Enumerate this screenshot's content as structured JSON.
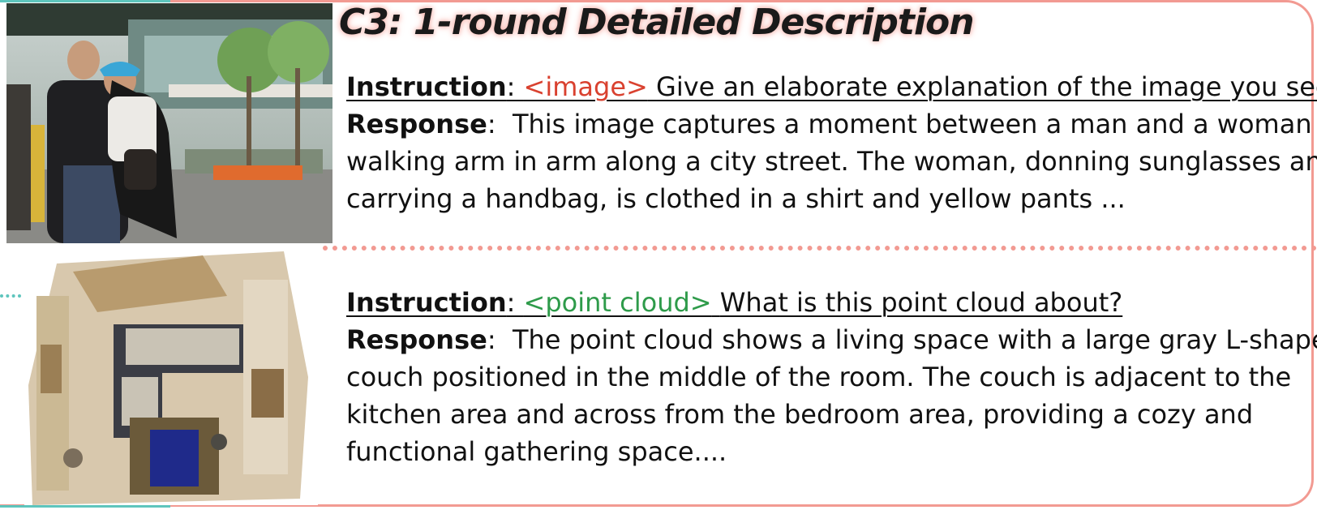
{
  "title": "C3: 1-round Detailed Description",
  "example1": {
    "instruction_label": "Instruction",
    "token": "<image>",
    "instruction_text": "Give an elaborate explanation of the image you see.",
    "response_label": "Response",
    "response_lines": [
      "This image captures a moment between a man and a woman",
      "walking arm in arm along a city street. The woman, donning sunglasses and",
      "carrying a handbag, is clothed in a shirt and yellow pants ..."
    ]
  },
  "example2": {
    "instruction_label": "Instruction",
    "token": "<point cloud>",
    "instruction_text": "What is this point cloud about?",
    "response_label": "Response",
    "response_lines": [
      "The point cloud shows a living space with a large gray L-shaped",
      "couch positioned in the middle of the room. The couch is adjacent to the",
      "kitchen area and across from the bedroom area, providing a cozy and",
      "functional gathering space...."
    ]
  },
  "colors": {
    "border": "#f29a92",
    "accent_teal": "#5ec5bd",
    "image_token": "#d9412f",
    "point_cloud_token": "#2e9b4a"
  }
}
